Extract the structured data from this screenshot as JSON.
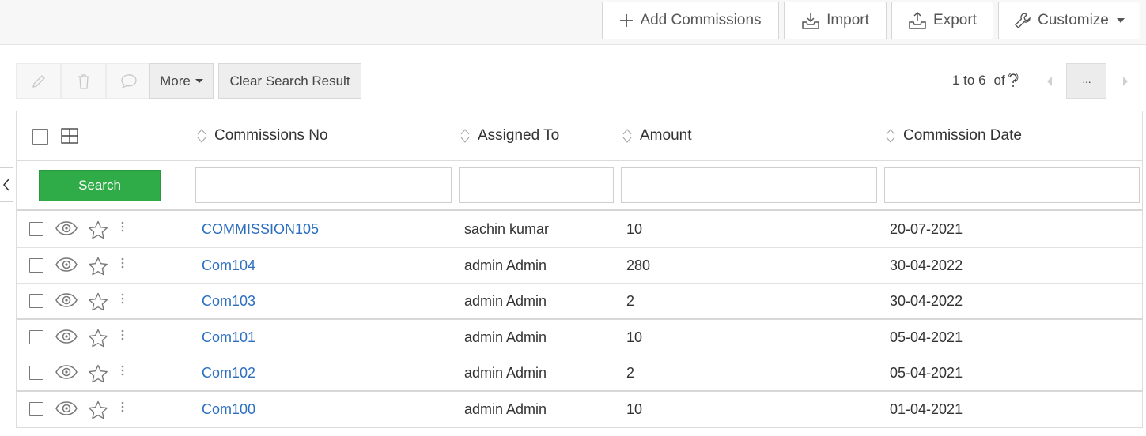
{
  "toolbar": {
    "add_label": "Add Commissions",
    "import_label": "Import",
    "export_label": "Export",
    "customize_label": "Customize"
  },
  "actions": {
    "more_label": "More",
    "clear_label": "Clear Search Result",
    "pager_range": "1 to 6",
    "pager_of": "of",
    "pager_more": "···"
  },
  "grid": {
    "columns": [
      "Commissions No",
      "Assigned To",
      "Amount",
      "Commission Date"
    ],
    "search_label": "Search",
    "rows": [
      {
        "no": "COMMISSION105",
        "assigned": "sachin kumar",
        "amount": "10",
        "date": "20-07-2021"
      },
      {
        "no": "Com104",
        "assigned": "admin Admin",
        "amount": "280",
        "date": "30-04-2022"
      },
      {
        "no": "Com103",
        "assigned": "admin Admin",
        "amount": "2",
        "date": "30-04-2022"
      },
      {
        "no": "Com101",
        "assigned": "admin Admin",
        "amount": "10",
        "date": "05-04-2021"
      },
      {
        "no": "Com102",
        "assigned": "admin Admin",
        "amount": "2",
        "date": "05-04-2021"
      },
      {
        "no": "Com100",
        "assigned": "admin Admin",
        "amount": "10",
        "date": "01-04-2021"
      }
    ]
  },
  "colors": {
    "link": "#2c6fbf",
    "search_button": "#2fab47"
  },
  "icons": [
    "plus-icon",
    "import-icon",
    "export-icon",
    "wrench-icon",
    "pencil-icon",
    "trash-icon",
    "comment-icon",
    "eye-icon",
    "star-icon",
    "kebab-icon",
    "grid-icon",
    "sort-icon",
    "question-icon",
    "chevron-left-icon",
    "chevron-right-icon"
  ]
}
